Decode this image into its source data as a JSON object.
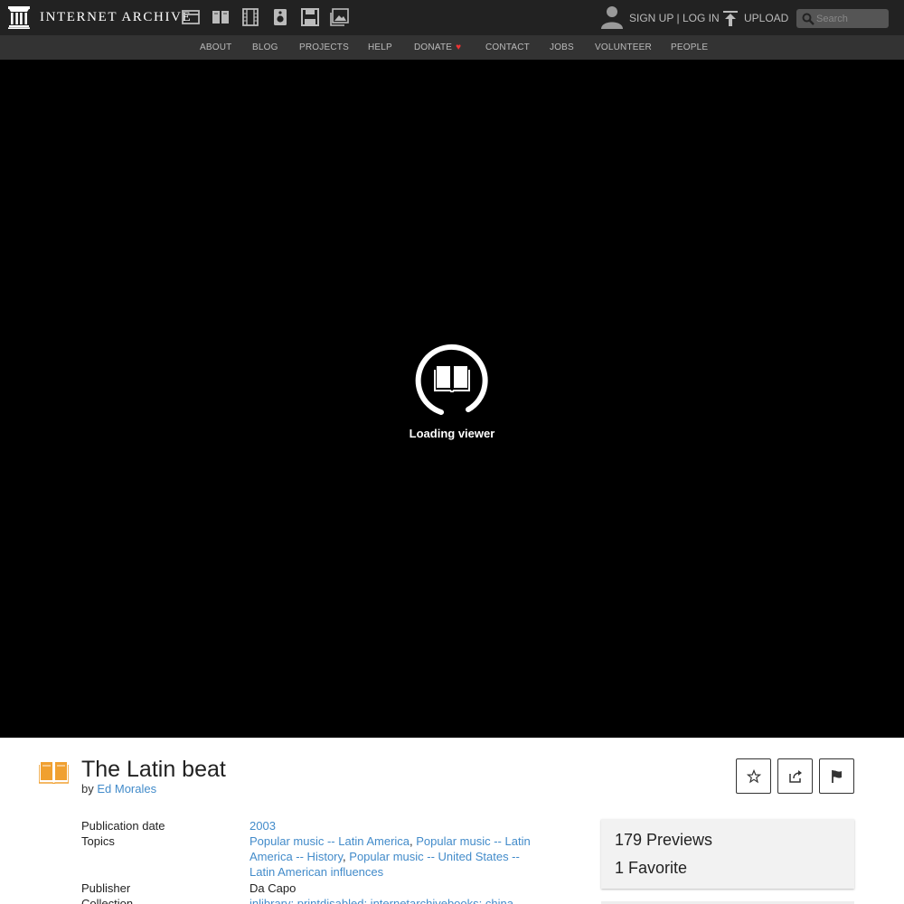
{
  "header": {
    "logo_text": "INTERNET ARCHIVE",
    "media_icons": [
      "web-icon",
      "texts-icon",
      "video-icon",
      "audio-icon",
      "software-icon",
      "images-icon"
    ],
    "sign_up": "SIGN UP",
    "separator": "|",
    "log_in": "LOG IN",
    "upload": "UPLOAD",
    "search_placeholder": "Search"
  },
  "subnav": {
    "items": [
      "ABOUT",
      "BLOG",
      "PROJECTS",
      "HELP",
      "DONATE",
      "CONTACT",
      "JOBS",
      "VOLUNTEER",
      "PEOPLE"
    ],
    "donate_heart": "♥"
  },
  "viewer": {
    "loading_text": "Loading viewer"
  },
  "item": {
    "title": "The Latin beat",
    "by": "by",
    "author": "Ed Morales",
    "metadata": {
      "publication_date_label": "Publication date",
      "publication_date": "2003",
      "topics_label": "Topics",
      "topics": [
        "Popular music -- Latin America",
        "Popular music -- Latin America -- History",
        "Popular music -- United States -- Latin American influences"
      ],
      "topics_sep": ", ",
      "publisher_label": "Publisher",
      "publisher": "Da Capo",
      "collection_label": "Collection",
      "collection": "inlibrary; printdisabled; internetarchivebooks; china"
    },
    "stats": {
      "previews": "179 Previews",
      "favorites": "1 Favorite"
    }
  },
  "colors": {
    "topbar": "#222222",
    "subnav": "#333333",
    "link": "#428bca",
    "book_icon": "#f0a030",
    "heart": "#ee3333"
  }
}
